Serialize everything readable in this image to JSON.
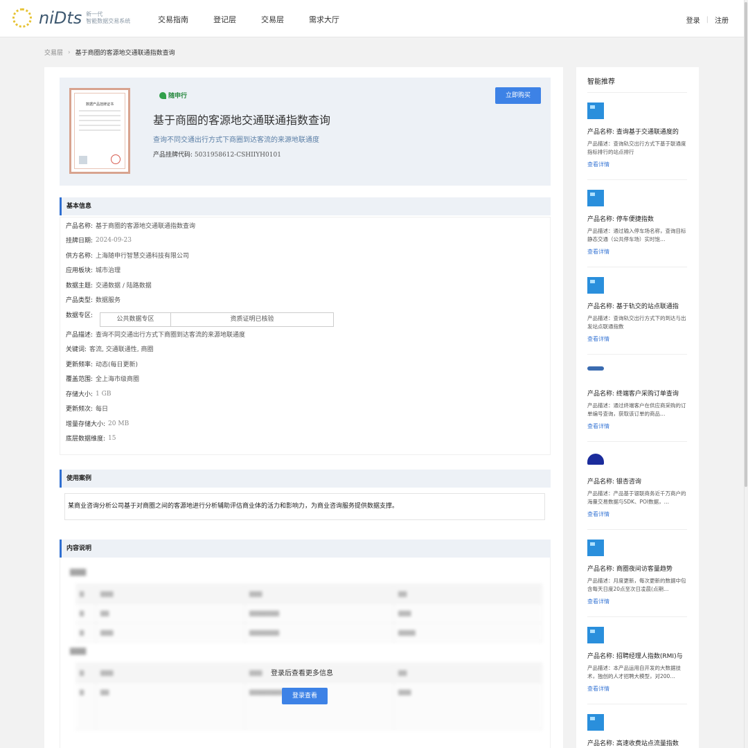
{
  "header": {
    "logo_text": "niDts",
    "logo_sub1": "新一代",
    "logo_sub2": "智能数据交易系统",
    "nav": [
      "交易指南",
      "登记层",
      "交易层",
      "需求大厅"
    ],
    "login": "登录",
    "register": "注册"
  },
  "breadcrumb": {
    "parent": "交易层",
    "current": "基于商圈的客源地交通联通指数查询"
  },
  "hero": {
    "brand": "随申行",
    "title": "基于商圈的客源地交通联通指数查询",
    "subtitle": "查询不同交通出行方式下商圈到达客流的来源地联通度",
    "code_label": "产品挂牌代码:",
    "code_value": "5031958612-CSHIIYH0101",
    "buy_label": "立即购买",
    "cert_title": "数据产品挂牌证书"
  },
  "basic_info": {
    "heading": "基本信息",
    "rows": [
      {
        "label": "产品名称:",
        "value": "基于商圈的客源地交通联通指数查询"
      },
      {
        "label": "挂牌日期:",
        "value": "2024-09-23"
      },
      {
        "label": "供方名称:",
        "value": "上海随申行智慧交通科技有限公司"
      },
      {
        "label": "应用板块:",
        "value": "城市治理"
      },
      {
        "label": "数据主题:",
        "value": "交通数据 / 陆路数据"
      },
      {
        "label": "产品类型:",
        "value": "数据服务"
      },
      {
        "label": "数据专区:",
        "value": ""
      },
      {
        "label": "产品描述:",
        "value": "查询不同交通出行方式下商圈到达客流的来源地联通度"
      },
      {
        "label": "关键词:",
        "value": "客流, 交通联通性, 商圈"
      },
      {
        "label": "更新频率:",
        "value": "动态(每日更新)"
      },
      {
        "label": "覆盖范围:",
        "value": "全上海市级商圈"
      },
      {
        "label": "存储大小:",
        "value": "1 GB"
      },
      {
        "label": "更新频次:",
        "value": "每日"
      },
      {
        "label": "增量存储大小:",
        "value": "20 MB"
      },
      {
        "label": "底层数据维度:",
        "value": "15"
      }
    ],
    "zone_a": "公共数据专区",
    "zone_b": "资质证明已核验"
  },
  "use_case": {
    "heading": "使用案例",
    "text": "某商业咨询分析公司基于对商圈之间的客源地进行分析辅助评估商业体的活力和影响力，为商业咨询服务提供数据支撑。"
  },
  "content": {
    "heading": "内容说明",
    "login_prompt": "登录后查看更多信息",
    "login_button": "登录查看"
  },
  "sidebar": {
    "title": "智能推荐",
    "link_label": "查看详情",
    "items": [
      {
        "name": "产品名称: 查询基于交通联通度的",
        "desc": "产品描述：查询轨交出行方式下基于联通度指标排行的站点排行"
      },
      {
        "name": "产品名称: 停车便捷指数",
        "desc": "产品描述：通过输入停车场名称，查询目标静态交通（公共停车场）实时饱…"
      },
      {
        "name": "产品名称: 基于轨交的站点联通指",
        "desc": "产品描述：查询轨交出行方式下的到达与出发站点联通指数"
      },
      {
        "name": "产品名称: 终端客户采购订单查询",
        "desc": "产品描述：通过终端客户在供应商采购的订单编号查询，获取该订单的商品…"
      },
      {
        "name": "产品名称: 银杏咨询",
        "desc": "产品描述：产品基于银联商务近千万商户的海量交易数据与SDK、POI数据，…"
      },
      {
        "name": "产品名称: 商圈夜间访客量趋势",
        "desc": "产品描述：月度更新，每次更新的数据中包含每天日度20点至次日凌晨(点期…"
      },
      {
        "name": "产品名称: 招聘经理人指数(RMI)与",
        "desc": "产品描述：本产品运用自开发的大数据技术，独创的人才招聘大模型，对200…"
      },
      {
        "name": "产品名称: 高速收费站点流量指数",
        "desc": ""
      }
    ]
  }
}
